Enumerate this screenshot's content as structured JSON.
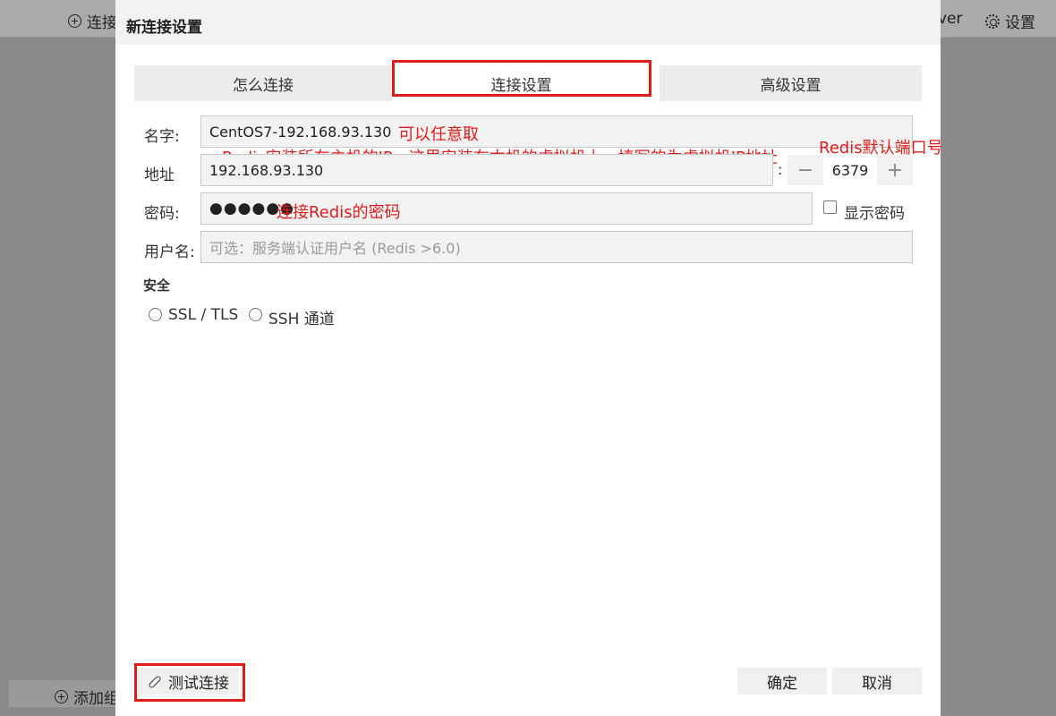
{
  "background": {
    "top_left_label": "连接",
    "top_right_partial": "ver",
    "settings_label": "设置",
    "bottom_left_label": "添加组"
  },
  "dialog": {
    "title": "新连接设置",
    "tabs": [
      {
        "label": "怎么连接"
      },
      {
        "label": "连接设置"
      },
      {
        "label": "高级设置"
      }
    ],
    "fields": {
      "name_label": "名字:",
      "name_value": "CentOS7-192.168.93.130",
      "address_label": "地址",
      "address_value": "192.168.93.130",
      "port_colon": ":",
      "port_value": "6379",
      "port_minus": "−",
      "port_plus": "+",
      "password_label": "密码:",
      "password_value": "●●●●●●",
      "show_password_label": "显示密码",
      "username_label": "用户名:",
      "username_placeholder": "可选：服务端认证用户名 (Redis >6.0)"
    },
    "security": {
      "heading": "安全",
      "options": [
        {
          "label": "SSL / TLS"
        },
        {
          "label": "SSH 通道"
        }
      ]
    },
    "buttons": {
      "test_connection": "测试连接",
      "confirm": "确定",
      "cancel": "取消"
    }
  },
  "annotations": {
    "name_note": "可以任意取",
    "address_note": "Redis安装所在主机的IP，这里安装在本机的虚拟机上，填写的为虚拟机IP地址",
    "port_note": "Redis默认端口号",
    "password_note": "连接Redis的密码"
  },
  "colors": {
    "annotation_red": "#e21b1b"
  }
}
